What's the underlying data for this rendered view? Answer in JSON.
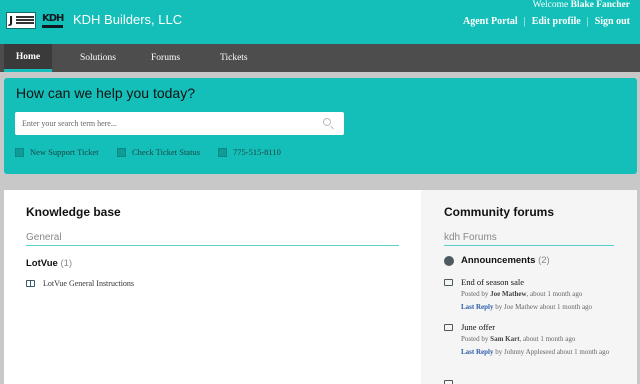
{
  "header": {
    "brand": "KDH Builders, LLC",
    "welcome_prefix": "Welcome",
    "user_name": "Blake Fancher",
    "links": [
      "Agent Portal",
      "Edit profile",
      "Sign out"
    ],
    "separator": "|"
  },
  "nav": {
    "items": [
      "Home",
      "Solutions",
      "Forums",
      "Tickets"
    ],
    "active": "Home"
  },
  "hero": {
    "title": "How can we help you today?",
    "search_placeholder": "Enter your search term here...",
    "quick_links": [
      "New Support Ticket",
      "Check Ticket Status",
      "775-515-8110"
    ]
  },
  "knowledge_base": {
    "title": "Knowledge base",
    "section": "General",
    "category": "LotVue",
    "category_count": "(1)",
    "articles": [
      "LotVue General Instructions"
    ]
  },
  "forums": {
    "title": "Community forums",
    "section": "kdh Forums",
    "category": "Announcements",
    "category_count": "(2)",
    "topics": [
      {
        "title": "End of season sale",
        "posted_prefix": "Posted by",
        "author": "Joe Mathew",
        "posted_time": ", about 1 month ago",
        "last_reply_label": "Last Reply",
        "last_reply_text": "by Joe Mathew about 1 month ago"
      },
      {
        "title": "June offer",
        "posted_prefix": "Posted by",
        "author": "Sam Kart",
        "posted_time": ", about 1 month ago",
        "last_reply_label": "Last Reply",
        "last_reply_text": "by Johnny Appleseed about 1 month ago"
      }
    ]
  },
  "colors": {
    "accent": "#13bfb8",
    "nav": "#4d4d4d",
    "link": "#2e5ca8"
  }
}
